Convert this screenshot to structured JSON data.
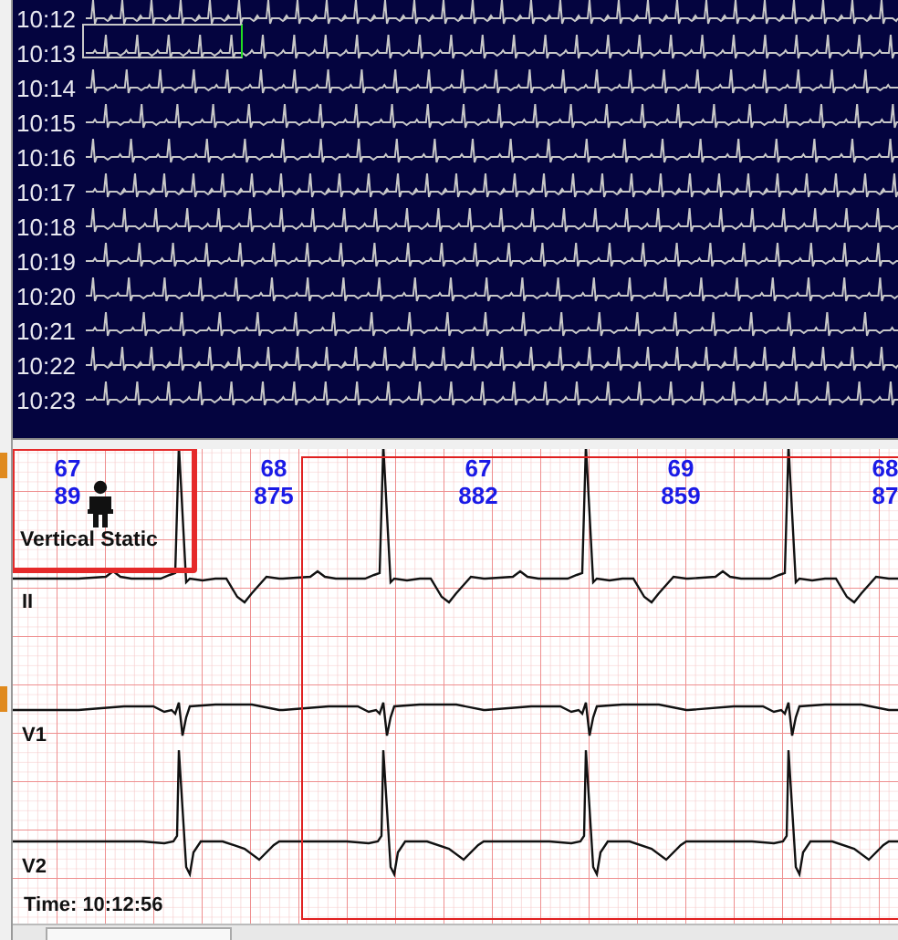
{
  "trend_rows": [
    {
      "time": "10:12"
    },
    {
      "time": "10:13"
    },
    {
      "time": "10:14"
    },
    {
      "time": "10:15"
    },
    {
      "time": "10:16"
    },
    {
      "time": "10:17"
    },
    {
      "time": "10:18"
    },
    {
      "time": "10:19"
    },
    {
      "time": "10:20"
    },
    {
      "time": "10:21"
    },
    {
      "time": "10:22"
    },
    {
      "time": "10:23"
    }
  ],
  "strip": {
    "beats": [
      {
        "rate": "67",
        "interval": "89"
      },
      {
        "rate": "68",
        "interval": "875"
      },
      {
        "rate": "67",
        "interval": "882"
      },
      {
        "rate": "69",
        "interval": "859"
      },
      {
        "rate": "68",
        "interval": "87"
      }
    ],
    "leads": [
      {
        "name": "II"
      },
      {
        "name": "V1"
      },
      {
        "name": "V2"
      }
    ],
    "posture": "Vertical Static",
    "time": "Time: 10:12:56"
  }
}
